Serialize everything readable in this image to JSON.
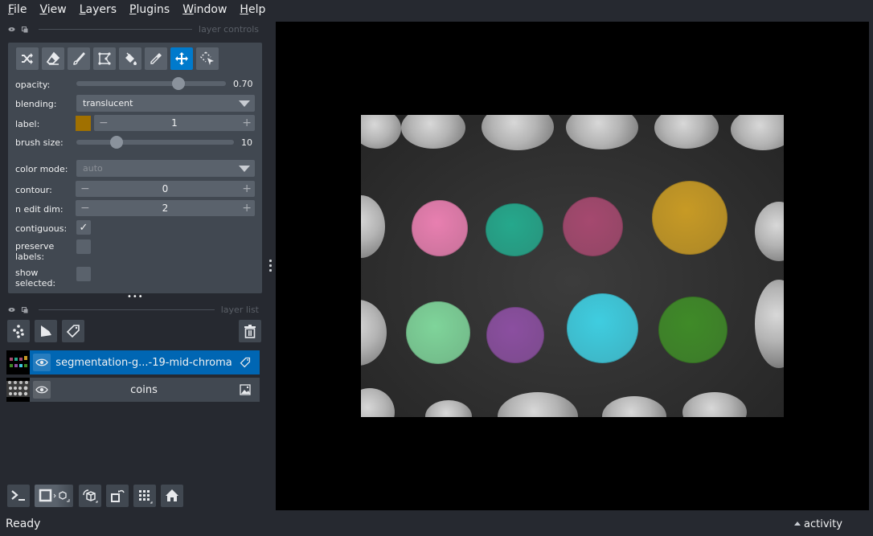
{
  "menubar": {
    "items": [
      {
        "label": "File",
        "mnemonic": "F",
        "rest": "ile"
      },
      {
        "label": "View",
        "mnemonic": "V",
        "rest": "iew"
      },
      {
        "label": "Layers",
        "mnemonic": "L",
        "rest": "ayers"
      },
      {
        "label": "Plugins",
        "mnemonic": "P",
        "rest": "lugins"
      },
      {
        "label": "Window",
        "mnemonic": "W",
        "rest": "indow"
      },
      {
        "label": "Help",
        "mnemonic": "H",
        "rest": "elp"
      }
    ]
  },
  "layer_controls": {
    "title": "layer controls",
    "tools": [
      {
        "name": "shuffle-colors",
        "icon": "shuffle-icon",
        "active": false
      },
      {
        "name": "erase",
        "icon": "eraser-icon",
        "active": false
      },
      {
        "name": "paint",
        "icon": "paint-brush-icon",
        "active": false
      },
      {
        "name": "polygon",
        "icon": "polygon-icon",
        "active": false
      },
      {
        "name": "fill",
        "icon": "fill-bucket-icon",
        "active": false
      },
      {
        "name": "pick",
        "icon": "color-picker-icon",
        "active": false
      },
      {
        "name": "pan-zoom",
        "icon": "move-icon",
        "active": true
      },
      {
        "name": "transform",
        "icon": "select-transform-icon",
        "active": false
      }
    ],
    "opacity": {
      "label": "opacity:",
      "value": 0.7,
      "display": "0.70"
    },
    "blending": {
      "label": "blending:",
      "value": "translucent"
    },
    "label": {
      "label": "label:",
      "value": "1",
      "color": "#a07000"
    },
    "brush_size": {
      "label": "brush size:",
      "value": 10,
      "min": 1,
      "max": 40,
      "display": "10"
    },
    "color_mode": {
      "label": "color mode:",
      "value": "auto"
    },
    "contour": {
      "label": "contour:",
      "value": "0"
    },
    "n_edit_dim": {
      "label": "n edit dim:",
      "value": "2"
    },
    "contiguous": {
      "label": "contiguous:",
      "checked": true,
      "check_glyph": "✓"
    },
    "preserve_labels": {
      "label_line1": "preserve",
      "label_line2": "labels:",
      "checked": false
    },
    "show_selected": {
      "label_line1": "show",
      "label_line2": "selected:",
      "checked": false
    }
  },
  "layer_list": {
    "title": "layer list",
    "buttons": [
      "new-points-layer",
      "new-shapes-layer",
      "new-labels-layer",
      "delete-layer"
    ],
    "layers": [
      {
        "name": "segmentation-g...-19-mid-chroma",
        "type": "labels",
        "selected": true,
        "visible": true
      },
      {
        "name": "coins",
        "type": "image",
        "selected": false,
        "visible": true
      }
    ]
  },
  "bottom_toolbar": {
    "buttons": [
      "console",
      "toggle-2d-3d",
      "roll-dimensions",
      "transpose-dimensions",
      "grid-mode",
      "reset-view"
    ]
  },
  "status": {
    "text": "Ready",
    "activity_label": "activity"
  },
  "colors": {
    "accent": "#007acc",
    "background": "#262930",
    "panel": "#414851",
    "control": "#5a626c"
  },
  "canvas": {
    "labels": [
      {
        "id": 1,
        "color": "#e87fb0"
      },
      {
        "id": 2,
        "color": "#25a88c"
      },
      {
        "id": 3,
        "color": "#a5496f"
      },
      {
        "id": 4,
        "color": "#c79a25"
      },
      {
        "id": 5,
        "color": "#7fd49a"
      },
      {
        "id": 6,
        "color": "#8b4fa0"
      },
      {
        "id": 7,
        "color": "#3fcde0"
      },
      {
        "id": 8,
        "color": "#3f8a28"
      }
    ]
  }
}
